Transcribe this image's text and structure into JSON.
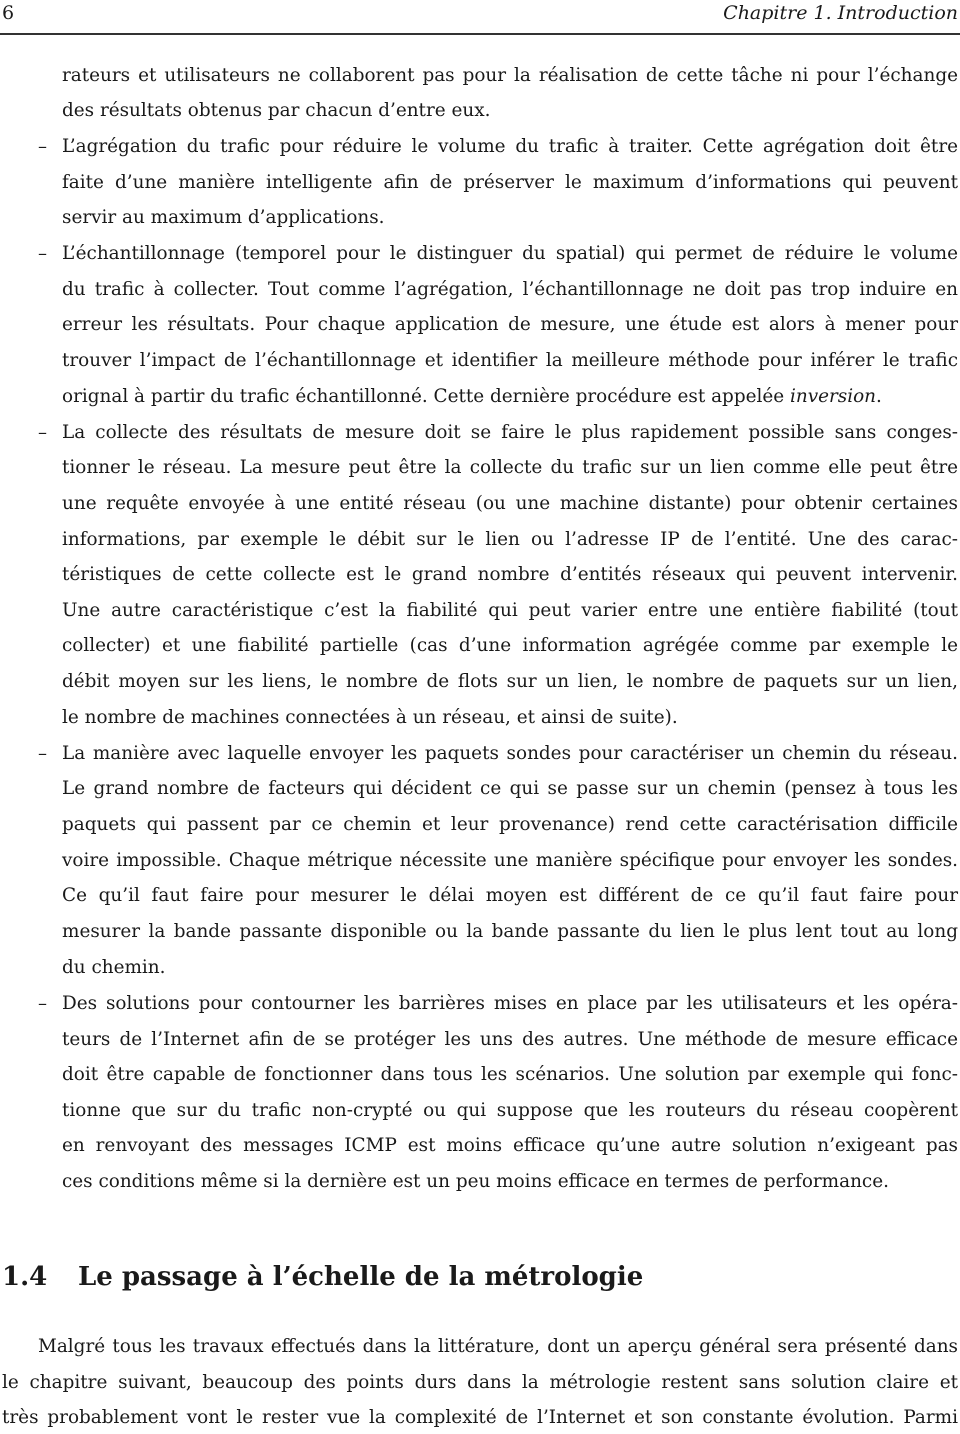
{
  "header": {
    "page_number": "6",
    "chapter_title": "Chapitre 1.  Introduction"
  },
  "continuation": {
    "lines": [
      "rateurs et utilisateurs ne collaborent pas pour la réalisation de cette tâche ni pour l’échange",
      "des résultats obtenus par chacun d’entre eux."
    ]
  },
  "bullets": [
    {
      "dash": "–",
      "lines": [
        "L’agrégation du trafic pour réduire le volume du trafic à traiter. Cette agrégation doit être",
        "faite d’une manière intelligente afin de préserver le maximum d’informations qui peuvent",
        "servir au maximum d’applications."
      ]
    },
    {
      "dash": "–",
      "lines": [
        "L’échantillonnage (temporel pour le distinguer du spatial) qui permet de réduire le volume",
        "du trafic à collecter. Tout comme l’agrégation, l’échantillonnage ne doit pas trop induire en",
        "erreur les résultats. Pour chaque application de mesure, une étude est alors à mener pour",
        "trouver l’impact de l’échantillonnage et identifier la meilleure méthode pour inférer le trafic"
      ],
      "last_line_prefix": "orignal à partir du trafic échantillonné. Cette dernière procédure est appelée ",
      "last_line_emphasis": "inversion",
      "last_line_suffix": "."
    },
    {
      "dash": "–",
      "lines": [
        "La collecte des résultats de mesure doit se faire le plus rapidement possible sans conges-",
        "tionner le réseau. La mesure peut être la collecte du trafic sur un lien comme elle peut être",
        "une requête envoyée à une entité réseau (ou une machine distante) pour obtenir certaines",
        "informations, par exemple le débit sur le lien ou l’adresse IP de l’entité. Une des carac-",
        "téristiques de cette collecte est le grand nombre d’entités réseaux qui peuvent intervenir.",
        "Une autre caractéristique c’est la fiabilité qui peut varier entre une entière fiabilité (tout",
        "collecter) et une fiabilité partielle (cas d’une information agrégée comme par exemple le",
        "débit moyen sur les liens, le nombre de flots sur un lien, le nombre de paquets sur un lien,",
        "le nombre de machines connectées à un réseau, et ainsi de suite)."
      ]
    },
    {
      "dash": "–",
      "lines": [
        "La manière avec laquelle envoyer les paquets sondes pour caractériser un chemin du réseau.",
        "Le grand nombre de facteurs qui décident ce qui se passe sur un chemin (pensez à tous les",
        "paquets qui passent par ce chemin et leur provenance) rend cette caractérisation difficile",
        "voire impossible. Chaque métrique nécessite une manière spécifique pour envoyer les sondes.",
        "Ce qu’il faut faire pour mesurer le délai moyen est différent de ce qu’il faut faire pour",
        "mesurer la bande passante disponible ou la bande passante du lien le plus lent tout au long",
        "du chemin."
      ]
    },
    {
      "dash": "–",
      "lines": [
        "Des solutions pour contourner les barrières mises en place par les utilisateurs et les opéra-",
        "teurs de l’Internet afin de se protéger les uns des autres. Une méthode de mesure efficace",
        "doit être capable de fonctionner dans tous les scénarios. Une solution par exemple qui fonc-",
        "tionne que sur du trafic non-crypté ou qui suppose que les routeurs du réseau coopèrent",
        "en renvoyant des messages ICMP est moins efficace qu’une autre solution n’exigeant pas",
        "ces conditions même si la dernière est un peu moins efficace en termes de performance."
      ]
    }
  ],
  "section": {
    "number": "1.4",
    "title": "Le passage à l’échelle de la métrologie"
  },
  "paragraph": {
    "lines": [
      "Malgré tous les travaux effectués dans la littérature, dont un aperçu général sera présenté dans",
      "le chapitre suivant, beaucoup des points durs dans la métrologie restent sans solution claire et",
      "très probablement vont le rester vue la complexité de l’Internet et son constante évolution. Parmi"
    ]
  }
}
